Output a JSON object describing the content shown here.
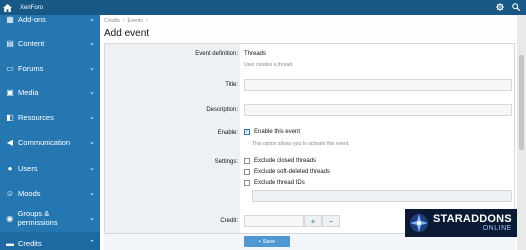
{
  "topbar": {
    "brand": "XenForo",
    "icons": [
      "home-icon",
      "settings-icon",
      "search-icon"
    ]
  },
  "sidebar": {
    "items": [
      {
        "label": "Add-ons",
        "icon": "puzzle-icon"
      },
      {
        "label": "Content",
        "icon": "content-icon"
      },
      {
        "label": "Forums",
        "icon": "forums-icon"
      },
      {
        "label": "Media",
        "icon": "media-icon"
      },
      {
        "label": "Resources",
        "icon": "resources-icon"
      },
      {
        "label": "Communication",
        "icon": "communication-icon"
      },
      {
        "label": "Users",
        "icon": "users-icon"
      },
      {
        "label": "Moods",
        "icon": "moods-icon"
      },
      {
        "label": "Groups & permissions",
        "icon": "groups-icon"
      },
      {
        "label": "Credits",
        "icon": "credits-icon"
      }
    ]
  },
  "breadcrumb": [
    "Credits",
    "Events"
  ],
  "page_title": "Add event",
  "form": {
    "event_definition": {
      "label": "Event definition:",
      "value": "Threads",
      "hint": "User creates a thread."
    },
    "title": {
      "label": "Title:",
      "value": ""
    },
    "description": {
      "label": "Description:",
      "value": ""
    },
    "enable": {
      "label": "Enable:",
      "checkbox_label": "Enable this event",
      "hint": "This option allows you to activate this event."
    },
    "settings": {
      "label": "Settings:",
      "options": [
        "Exclude closed threads",
        "Exclude soft-deleted threads",
        "Exclude thread IDs"
      ]
    },
    "credit": {
      "label": "Credit:",
      "value": "",
      "plus": "+",
      "minus": "−"
    }
  },
  "save_button": "Save",
  "watermark": {
    "line1": "STARADDONS",
    "line2": "ONLINE"
  }
}
